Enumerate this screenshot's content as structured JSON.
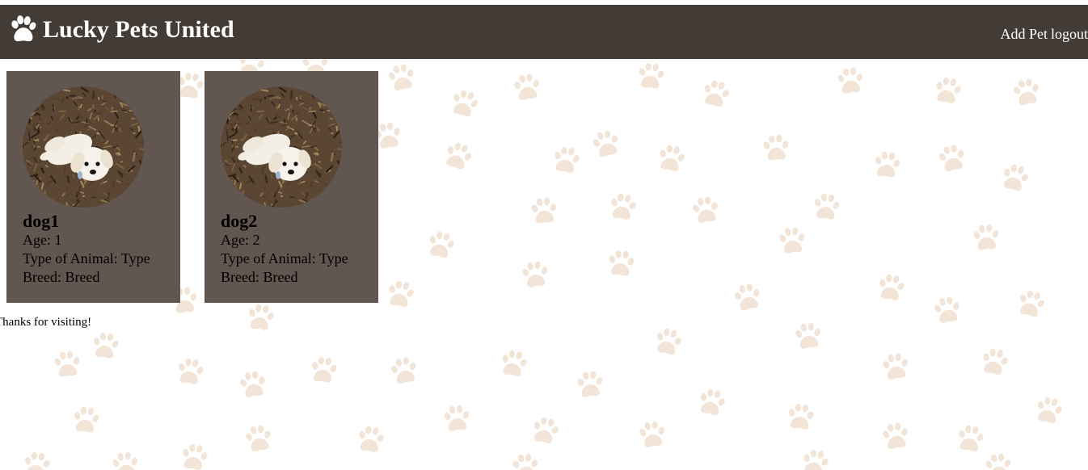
{
  "header": {
    "logo_icon": "paw-icon",
    "title": "Lucky Pets United",
    "nav": {
      "add_pet": "Add Pet",
      "logout": "logout"
    }
  },
  "colors": {
    "header_bg": "#433b36",
    "card_bg": "#615650",
    "paw_pattern": "#f2e4d6"
  },
  "pets": [
    {
      "name": "dog1",
      "age": "Age: 1",
      "type": "Type of Animal: Type",
      "breed": "Breed: Breed",
      "photo_icon": "dog-photo"
    },
    {
      "name": "dog2",
      "age": "Age: 2",
      "type": "Type of Animal: Type",
      "breed": "Breed: Breed",
      "photo_icon": "dog-photo"
    }
  ],
  "footer": {
    "text": "Thanks for visiting!"
  }
}
